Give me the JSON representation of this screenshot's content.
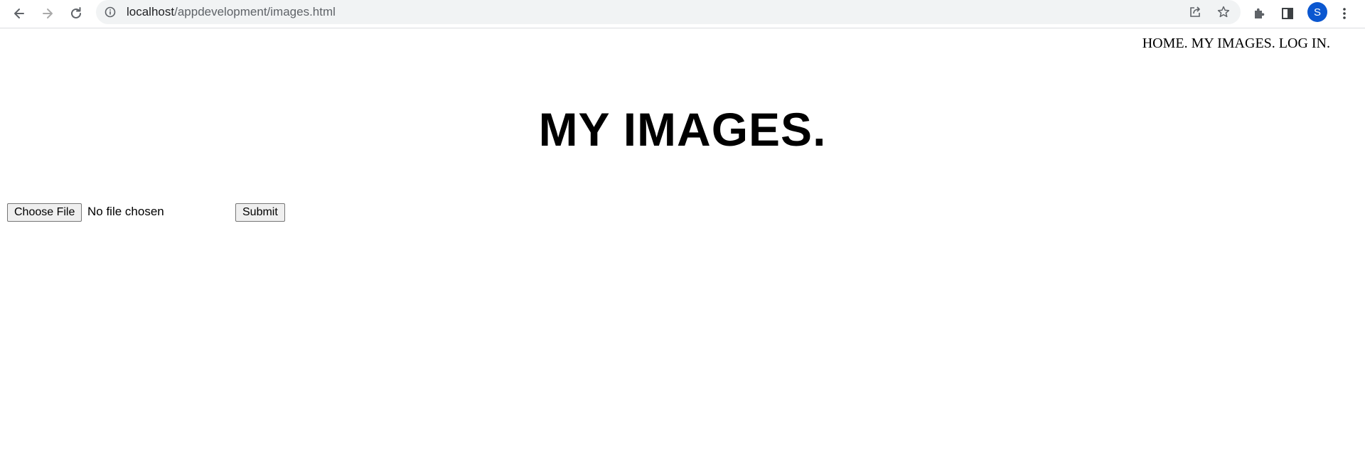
{
  "browser": {
    "url_host": "localhost",
    "url_path": "/appdevelopment/images.html",
    "profile_initial": "S"
  },
  "nav": {
    "items": [
      "HOME.",
      "MY IMAGES.",
      "LOG IN."
    ]
  },
  "page": {
    "title": "MY IMAGES."
  },
  "upload": {
    "choose_label": "Choose File",
    "file_status": "No file chosen",
    "submit_label": "Submit"
  }
}
